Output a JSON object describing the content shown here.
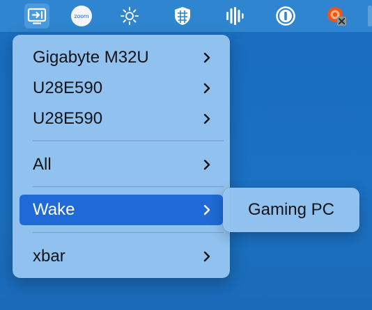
{
  "menubar": {
    "icons": [
      {
        "name": "display-switch-icon",
        "active": true
      },
      {
        "name": "zoom-icon",
        "text": "zoom"
      },
      {
        "name": "brightness-icon"
      },
      {
        "name": "shield-icon"
      },
      {
        "name": "audio-levels-icon"
      },
      {
        "name": "1password-icon"
      },
      {
        "name": "vpn-disconnected-icon"
      }
    ]
  },
  "menu": {
    "items": [
      {
        "label": "Gigabyte M32U",
        "submenu": true
      },
      {
        "label": "U28E590",
        "submenu": true
      },
      {
        "label": "U28E590",
        "submenu": true
      },
      {
        "label": "All",
        "submenu": true
      },
      {
        "label": "Wake",
        "submenu": true,
        "highlighted": true
      },
      {
        "label": "xbar",
        "submenu": true
      }
    ]
  },
  "submenu": {
    "items": [
      {
        "label": "Gaming PC"
      }
    ]
  },
  "colors": {
    "desktop": "#1a6fc0",
    "menubar": "#2f85cf",
    "menu_bg": "#96c4f0",
    "highlight": "#1f6ad6",
    "text": "#101418"
  }
}
